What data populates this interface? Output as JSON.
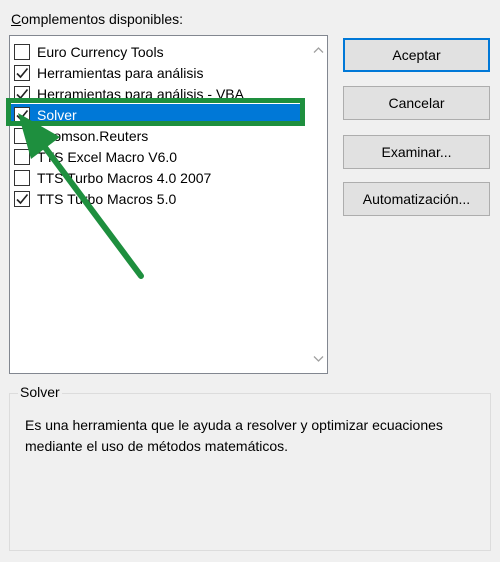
{
  "dialog": {
    "caption_prefix": "C",
    "caption_rest": "omplementos disponibles:"
  },
  "addins": [
    {
      "label": "Euro Currency Tools",
      "checked": false,
      "selected": false
    },
    {
      "label": "Herramientas para análisis",
      "checked": true,
      "selected": false
    },
    {
      "label": "Herramientas para análisis - VBA",
      "checked": true,
      "selected": false
    },
    {
      "label": "Solver",
      "checked": true,
      "selected": true
    },
    {
      "label": "Thomson.Reuters",
      "checked": false,
      "selected": false
    },
    {
      "label": "TTS Excel Macro V6.0",
      "checked": false,
      "selected": false
    },
    {
      "label": "TTS Turbo Macros 4.0 2007",
      "checked": false,
      "selected": false
    },
    {
      "label": "TTS Turbo Macros 5.0",
      "checked": true,
      "selected": false
    }
  ],
  "buttons": {
    "accept": "Aceptar",
    "cancel": "Cancelar",
    "browse": "Examinar...",
    "automation": "Automatización..."
  },
  "details": {
    "title": "Solver",
    "description": "Es una herramienta que le ayuda a resolver y optimizar ecuaciones mediante el uso de métodos matemáticos."
  },
  "colors": {
    "selection": "#0078d7",
    "annotation": "#1e8f3e"
  },
  "icons": {
    "checkmark": "checkmark-icon",
    "scroll_up": "chevron-up-icon",
    "scroll_down": "chevron-down-icon",
    "annotation": "arrow-annotation-icon"
  }
}
